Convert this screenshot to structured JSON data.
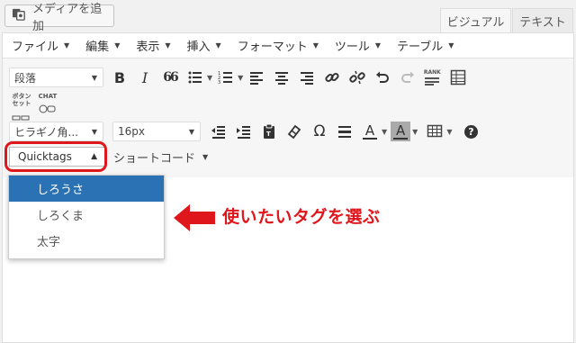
{
  "media_button": {
    "label": "メディアを追加",
    "icon": "add-media-icon"
  },
  "tabs": [
    {
      "label": "ビジュアル",
      "active": true
    },
    {
      "label": "テキスト",
      "active": false
    }
  ],
  "menubar": [
    "ファイル",
    "編集",
    "表示",
    "挿入",
    "フォーマット",
    "ツール",
    "テーブル"
  ],
  "toolbar1": {
    "format_select": "段落",
    "buttons": [
      "bold-icon",
      "italic-icon",
      "blockquote-icon",
      "bullet-list-icon",
      "numbered-list-icon",
      "align-left-icon",
      "align-center-icon",
      "align-right-icon",
      "link-icon",
      "unlink-icon",
      "undo-icon",
      "redo-icon",
      "rank-icon",
      "table-grid-icon"
    ],
    "bold": "B",
    "italic": "I",
    "quote": "66",
    "rank_label": "RANK",
    "button_set_label": "ボタン セット",
    "chat_label": "CHAT"
  },
  "toolbar2": {
    "font_family": "ヒラギノ角...",
    "font_size": "16px",
    "omega": "Ω",
    "text_color_letter": "A",
    "bg_color_letter": "A",
    "help": "?"
  },
  "quicktags": {
    "label": "Quicktags",
    "arrow": "▲",
    "items": [
      "しろうさ",
      "しろくま",
      "太字"
    ],
    "selected_index": 0,
    "highlight_color": "#e0161d"
  },
  "shortcode": {
    "label": "ショートコード",
    "caret": "▼"
  },
  "annotation": {
    "text": "使いたいタグを選ぶ",
    "color": "#e0161d"
  },
  "caret": "▼"
}
